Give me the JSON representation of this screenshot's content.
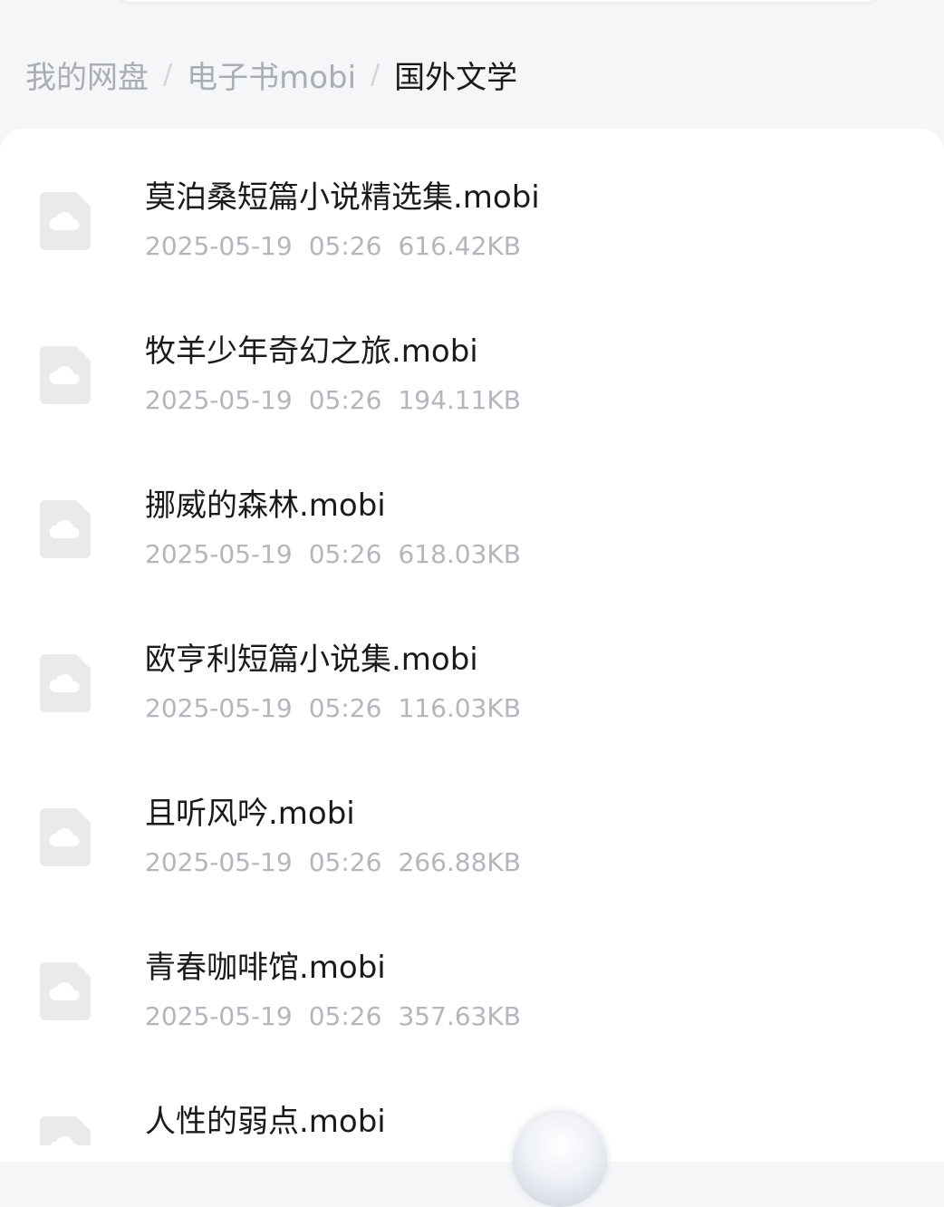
{
  "breadcrumb": {
    "root": "我的网盘",
    "parent": "电子书mobi",
    "current": "国外文学",
    "separator": "/"
  },
  "colors": {
    "background": "#f5f6f8",
    "list_background": "#ffffff",
    "breadcrumb_inactive": "#a9adb4",
    "text_primary": "#1a1a1a",
    "text_secondary": "#b3b6bc",
    "file_icon_fill": "#e9eaec"
  },
  "files": [
    {
      "name": "莫泊桑短篇小说精选集.mobi",
      "date": "2025-05-19",
      "time": "05:26",
      "size": "616.42KB",
      "icon": "cloud-file-icon"
    },
    {
      "name": "牧羊少年奇幻之旅.mobi",
      "date": "2025-05-19",
      "time": "05:26",
      "size": "194.11KB",
      "icon": "cloud-file-icon"
    },
    {
      "name": "挪威的森林.mobi",
      "date": "2025-05-19",
      "time": "05:26",
      "size": "618.03KB",
      "icon": "cloud-file-icon"
    },
    {
      "name": "欧亨利短篇小说集.mobi",
      "date": "2025-05-19",
      "time": "05:26",
      "size": "116.03KB",
      "icon": "cloud-file-icon"
    },
    {
      "name": "且听风吟.mobi",
      "date": "2025-05-19",
      "time": "05:26",
      "size": "266.88KB",
      "icon": "cloud-file-icon"
    },
    {
      "name": "青春咖啡馆.mobi",
      "date": "2025-05-19",
      "time": "05:26",
      "size": "357.63KB",
      "icon": "cloud-file-icon"
    },
    {
      "name": "人性的弱点.mobi",
      "icon": "cloud-file-icon"
    }
  ]
}
